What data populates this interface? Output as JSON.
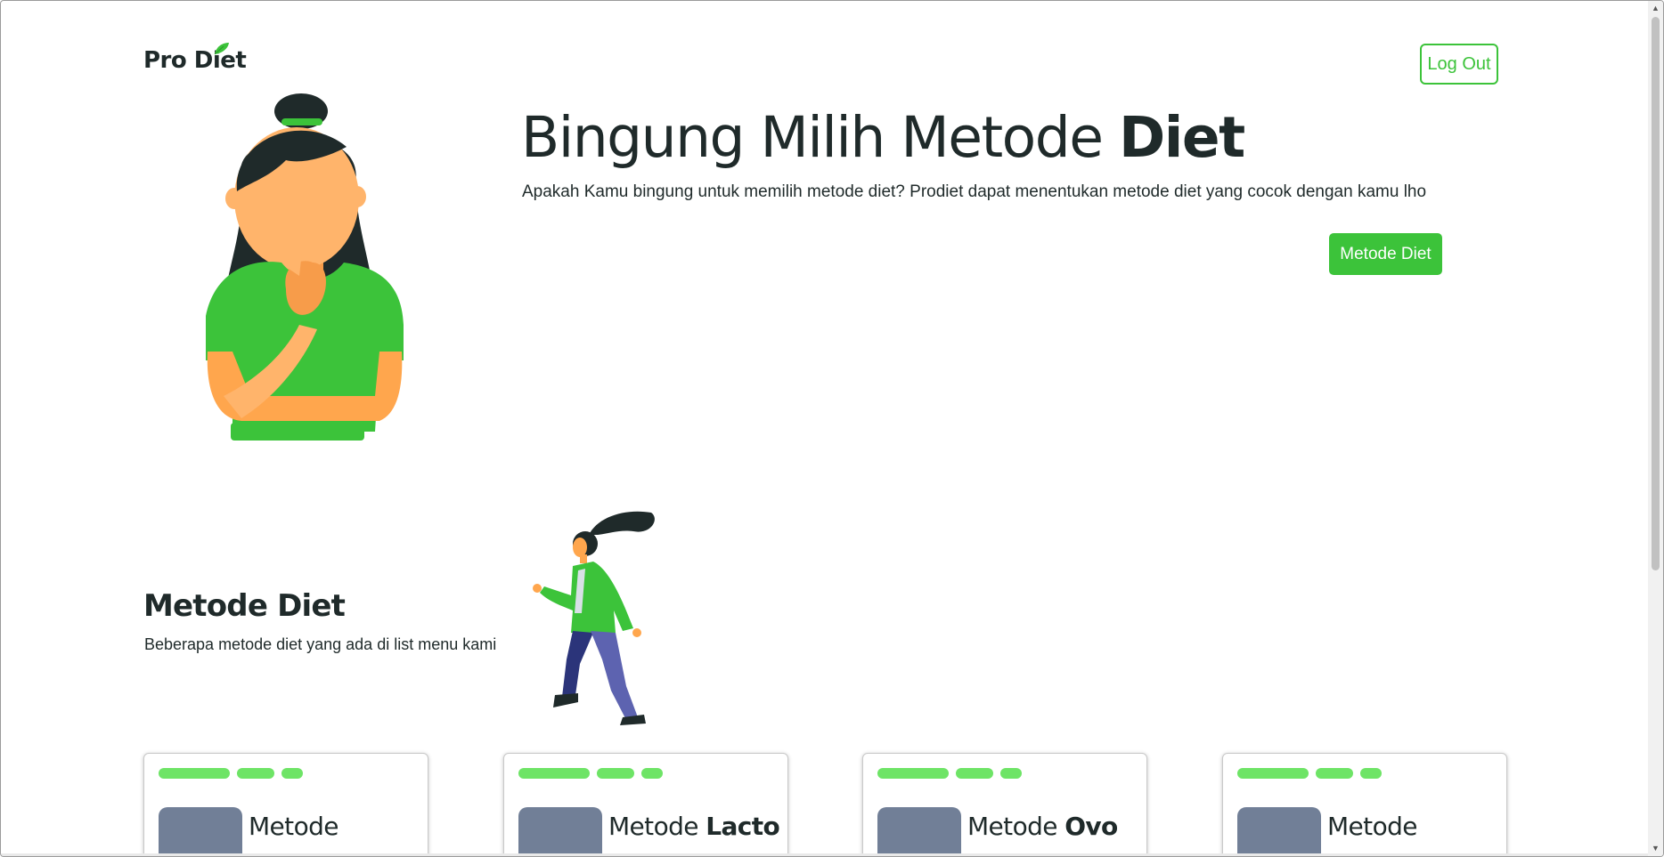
{
  "header": {
    "logo_text": "Pro Diet",
    "logout_label": "Log Out"
  },
  "hero": {
    "title_regular": "Bingung Milih Metode ",
    "title_bold": "Diet",
    "description": "Apakah Kamu bingung untuk memilih metode diet? Prodiet dapat menentukan metode diet yang cocok dengan kamu lho",
    "button_label": "Metode Diet"
  },
  "section": {
    "title": "Metode Diet",
    "description": "Beberapa metode diet yang ada di list menu kami"
  },
  "cards": [
    {
      "title_regular": "Metode",
      "title_bold": ""
    },
    {
      "title_regular": "Metode ",
      "title_bold": "Lacto"
    },
    {
      "title_regular": "Metode ",
      "title_bold": "Ovo"
    },
    {
      "title_regular": "Metode",
      "title_bold": ""
    }
  ],
  "colors": {
    "brand_green": "#3cc33a",
    "pill_green": "#6ee466",
    "text_dark": "#1f2a2a",
    "thumb_gray": "#717f97"
  },
  "icons": {
    "logo_leaf": "leaf-icon",
    "scroll_up": "chevron-up-icon",
    "scroll_down": "chevron-down-icon"
  }
}
